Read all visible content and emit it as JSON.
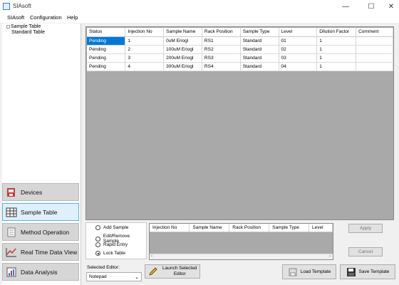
{
  "window": {
    "title": "SIAsoft",
    "minimize": "—",
    "maximize": "☐",
    "close": "✕"
  },
  "menu": [
    "SIAsoft",
    "Configuration",
    "Help"
  ],
  "tree": [
    "Sample Table",
    "Standard Table"
  ],
  "nav": [
    {
      "label": "Devices",
      "icon": "devices-icon"
    },
    {
      "label": "Sample Table",
      "icon": "table-icon"
    },
    {
      "label": "Method Operation",
      "icon": "method-icon"
    },
    {
      "label": "Real Time Data View",
      "icon": "chart-icon"
    },
    {
      "label": "Data Analysis",
      "icon": "analysis-icon"
    }
  ],
  "grid": {
    "columns": [
      "Status",
      "Injection No",
      "Sample Name",
      "Rack Position",
      "Sample Type",
      "Level",
      "Dilution Factor",
      "Comment"
    ],
    "rows": [
      [
        "Pending",
        "1",
        "0uM Eriogl",
        "RS1",
        "Standard",
        "01",
        "1",
        ""
      ],
      [
        "Pending",
        "2",
        "100uM Eriogl",
        "RS2",
        "Standard",
        "02",
        "1",
        ""
      ],
      [
        "Pending",
        "3",
        "200uM Eriogl",
        "RS3",
        "Standard",
        "03",
        "1",
        ""
      ],
      [
        "Pending",
        "4",
        "300uM Eriogl",
        "RS4",
        "Standard",
        "04",
        "1",
        ""
      ]
    ]
  },
  "options": {
    "items": [
      "Add Sample",
      "Edit/Remove Sample",
      "Rapid Entry",
      "Lock Table"
    ],
    "selected": "Lock Table"
  },
  "subgrid": {
    "columns": [
      "Injection No",
      "Sample Name",
      "Rack Position",
      "Sample Type",
      "Level"
    ]
  },
  "buttons": {
    "apply": "Apply",
    "cancel": "Cancel",
    "launch_line1": "Launch Selected",
    "launch_line2": "Editor",
    "load_template": "Load Template",
    "save_template": "Save Template"
  },
  "editor": {
    "label": "Selected Editor:",
    "value": "Notepad"
  },
  "colors": {
    "selection": "#0078d7",
    "nav_active": "#dff0fb",
    "grid_bg": "#a9a9a9"
  }
}
